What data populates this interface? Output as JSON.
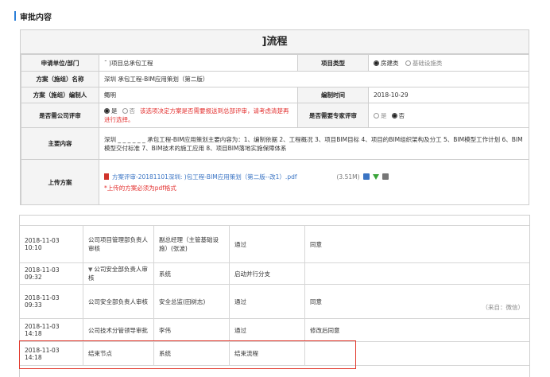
{
  "section": {
    "title": "审批内容"
  },
  "form": {
    "title": "]流程",
    "rows": {
      "applicant_label": "申请单位/部门",
      "applicant_value": "¯                    )项目总承包工程",
      "project_type_label": "项目类型",
      "project_type_options": [
        "房建类",
        "基础设施类"
      ],
      "scheme_name_label": "方案（施组）名称",
      "scheme_name_value": "深圳                    承包工程-BIM应用策划（第二版）",
      "author_label": "方案（施组）编制人",
      "author_value": "鲰明",
      "date_label": "编制时间",
      "date_value": "2018-10-29",
      "company_review_label": "是否需公司评审",
      "company_review_yes": "是",
      "company_review_no": "否",
      "company_review_warning": "该选项决定方案是否需要报送到总部评审，请考虑清楚再进行选择。",
      "expert_review_label": "是否需要专家评审",
      "expert_review_yes": "是",
      "expert_review_no": "否",
      "main_content_label": "主要内容",
      "main_content_value": "深圳 _ _ _ _ _ _ 承包工程-BIM应用策划主要内容为：1、编制依据 2、工程概况 3、项目BIM目标 4、项目的BIM组织架构及分工 5、BIM模型工作计划 6、BIM模型交付标准 7、BIM技术的施工应用 8、项目BIM落地实施保障体系",
      "upload_label": "上传方案",
      "upload_file": "方案评审-20181101深圳:                              )包工程-BIM应用策划（第二版--改1）.pdf",
      "upload_size": "(3.51M)",
      "upload_note": "*上传的方案必须为pdf格式"
    }
  },
  "log": {
    "rows": [
      {
        "time": "2018-11-03 10:10",
        "node": "公司项目管理部负责人审核",
        "person": "副总经理（主管基础设施）(张波)",
        "action": "通过",
        "comment": "同意"
      },
      {
        "time": "2018-11-03 09:32",
        "node": "公司安全部负责人审核",
        "person": "系统",
        "action": "启动并行分支",
        "comment": ""
      },
      {
        "time": "2018-11-03 09:33",
        "node": "公司安全部负责人审核",
        "person": "安全总监(田树志)",
        "action": "通过",
        "comment": "同意"
      },
      {
        "time": "2018-11-03 14:18",
        "node": "公司技术分管领导审批",
        "person": "李伟",
        "action": "通过",
        "comment": "修改后同意"
      },
      {
        "time": "2018-11-03 14:18",
        "node": "结束节点",
        "person": "系统",
        "action": "结束流程",
        "comment": ""
      }
    ],
    "source_note": "（来自：微信）",
    "expand_glyph": "▼"
  }
}
